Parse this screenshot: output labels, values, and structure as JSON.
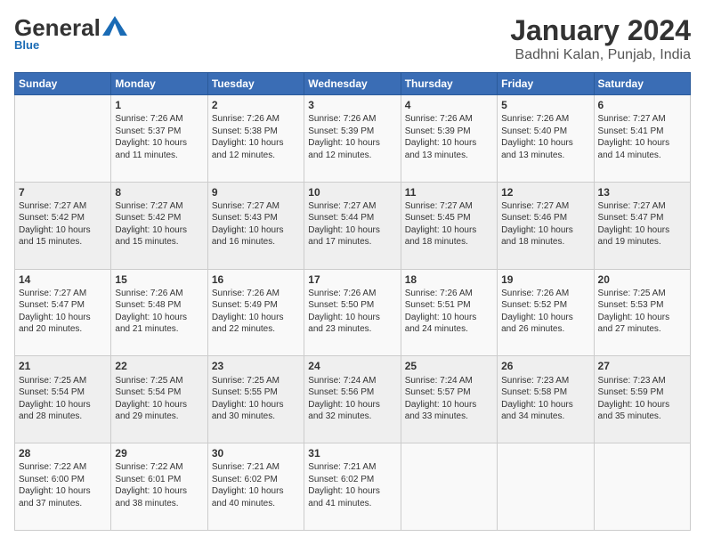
{
  "header": {
    "logo": {
      "general": "General",
      "blue": "Blue"
    },
    "title": "January 2024",
    "subtitle": "Badhni Kalan, Punjab, India"
  },
  "calendar": {
    "days_of_week": [
      "Sunday",
      "Monday",
      "Tuesday",
      "Wednesday",
      "Thursday",
      "Friday",
      "Saturday"
    ],
    "weeks": [
      [
        {
          "day": "",
          "info": ""
        },
        {
          "day": "1",
          "info": "Sunrise: 7:26 AM\nSunset: 5:37 PM\nDaylight: 10 hours\nand 11 minutes."
        },
        {
          "day": "2",
          "info": "Sunrise: 7:26 AM\nSunset: 5:38 PM\nDaylight: 10 hours\nand 12 minutes."
        },
        {
          "day": "3",
          "info": "Sunrise: 7:26 AM\nSunset: 5:39 PM\nDaylight: 10 hours\nand 12 minutes."
        },
        {
          "day": "4",
          "info": "Sunrise: 7:26 AM\nSunset: 5:39 PM\nDaylight: 10 hours\nand 13 minutes."
        },
        {
          "day": "5",
          "info": "Sunrise: 7:26 AM\nSunset: 5:40 PM\nDaylight: 10 hours\nand 13 minutes."
        },
        {
          "day": "6",
          "info": "Sunrise: 7:27 AM\nSunset: 5:41 PM\nDaylight: 10 hours\nand 14 minutes."
        }
      ],
      [
        {
          "day": "7",
          "info": "Sunrise: 7:27 AM\nSunset: 5:42 PM\nDaylight: 10 hours\nand 15 minutes."
        },
        {
          "day": "8",
          "info": "Sunrise: 7:27 AM\nSunset: 5:42 PM\nDaylight: 10 hours\nand 15 minutes."
        },
        {
          "day": "9",
          "info": "Sunrise: 7:27 AM\nSunset: 5:43 PM\nDaylight: 10 hours\nand 16 minutes."
        },
        {
          "day": "10",
          "info": "Sunrise: 7:27 AM\nSunset: 5:44 PM\nDaylight: 10 hours\nand 17 minutes."
        },
        {
          "day": "11",
          "info": "Sunrise: 7:27 AM\nSunset: 5:45 PM\nDaylight: 10 hours\nand 18 minutes."
        },
        {
          "day": "12",
          "info": "Sunrise: 7:27 AM\nSunset: 5:46 PM\nDaylight: 10 hours\nand 18 minutes."
        },
        {
          "day": "13",
          "info": "Sunrise: 7:27 AM\nSunset: 5:47 PM\nDaylight: 10 hours\nand 19 minutes."
        }
      ],
      [
        {
          "day": "14",
          "info": "Sunrise: 7:27 AM\nSunset: 5:47 PM\nDaylight: 10 hours\nand 20 minutes."
        },
        {
          "day": "15",
          "info": "Sunrise: 7:26 AM\nSunset: 5:48 PM\nDaylight: 10 hours\nand 21 minutes."
        },
        {
          "day": "16",
          "info": "Sunrise: 7:26 AM\nSunset: 5:49 PM\nDaylight: 10 hours\nand 22 minutes."
        },
        {
          "day": "17",
          "info": "Sunrise: 7:26 AM\nSunset: 5:50 PM\nDaylight: 10 hours\nand 23 minutes."
        },
        {
          "day": "18",
          "info": "Sunrise: 7:26 AM\nSunset: 5:51 PM\nDaylight: 10 hours\nand 24 minutes."
        },
        {
          "day": "19",
          "info": "Sunrise: 7:26 AM\nSunset: 5:52 PM\nDaylight: 10 hours\nand 26 minutes."
        },
        {
          "day": "20",
          "info": "Sunrise: 7:25 AM\nSunset: 5:53 PM\nDaylight: 10 hours\nand 27 minutes."
        }
      ],
      [
        {
          "day": "21",
          "info": "Sunrise: 7:25 AM\nSunset: 5:54 PM\nDaylight: 10 hours\nand 28 minutes."
        },
        {
          "day": "22",
          "info": "Sunrise: 7:25 AM\nSunset: 5:54 PM\nDaylight: 10 hours\nand 29 minutes."
        },
        {
          "day": "23",
          "info": "Sunrise: 7:25 AM\nSunset: 5:55 PM\nDaylight: 10 hours\nand 30 minutes."
        },
        {
          "day": "24",
          "info": "Sunrise: 7:24 AM\nSunset: 5:56 PM\nDaylight: 10 hours\nand 32 minutes."
        },
        {
          "day": "25",
          "info": "Sunrise: 7:24 AM\nSunset: 5:57 PM\nDaylight: 10 hours\nand 33 minutes."
        },
        {
          "day": "26",
          "info": "Sunrise: 7:23 AM\nSunset: 5:58 PM\nDaylight: 10 hours\nand 34 minutes."
        },
        {
          "day": "27",
          "info": "Sunrise: 7:23 AM\nSunset: 5:59 PM\nDaylight: 10 hours\nand 35 minutes."
        }
      ],
      [
        {
          "day": "28",
          "info": "Sunrise: 7:22 AM\nSunset: 6:00 PM\nDaylight: 10 hours\nand 37 minutes."
        },
        {
          "day": "29",
          "info": "Sunrise: 7:22 AM\nSunset: 6:01 PM\nDaylight: 10 hours\nand 38 minutes."
        },
        {
          "day": "30",
          "info": "Sunrise: 7:21 AM\nSunset: 6:02 PM\nDaylight: 10 hours\nand 40 minutes."
        },
        {
          "day": "31",
          "info": "Sunrise: 7:21 AM\nSunset: 6:02 PM\nDaylight: 10 hours\nand 41 minutes."
        },
        {
          "day": "",
          "info": ""
        },
        {
          "day": "",
          "info": ""
        },
        {
          "day": "",
          "info": ""
        }
      ]
    ]
  }
}
